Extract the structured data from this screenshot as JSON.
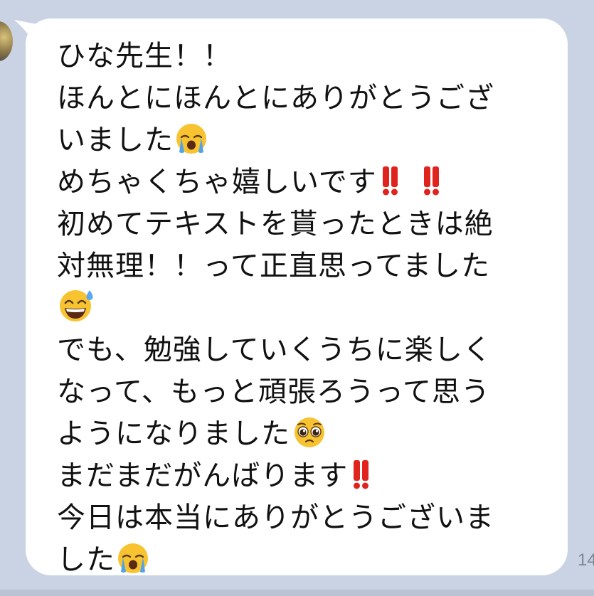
{
  "chat": {
    "timestamp": "14",
    "message_lines": [
      "ひな先生！！",
      "ほんとにほんとにありがとうござ",
      "いました",
      "めちゃくちゃ嬉しいです",
      "初めてテキストを貰ったときは絶",
      "対無理！！って正直思ってました",
      "",
      "でも、勉強していくうちに楽しく",
      "なって、もっと頑張ろうって思う",
      "ようになりました",
      "まだまだがんばります",
      "今日は本当にありがとうございま",
      "した"
    ],
    "emojis": {
      "line_3": "loudly-crying-face-emoji",
      "line_4": "double-exclamation-emoji",
      "line_7": "grinning-sweat-face-emoji",
      "line_10": "pleading-face-emoji",
      "line_11": "double-exclamation-emoji",
      "line_13": "loudly-crying-face-emoji"
    }
  },
  "colors": {
    "background": "#c9d3e3",
    "bubble": "#ffffff",
    "text": "#111111",
    "timestamp": "#7d8594",
    "exclamation_red": "#e0231d",
    "emoji_yellow": "#f7c331"
  }
}
